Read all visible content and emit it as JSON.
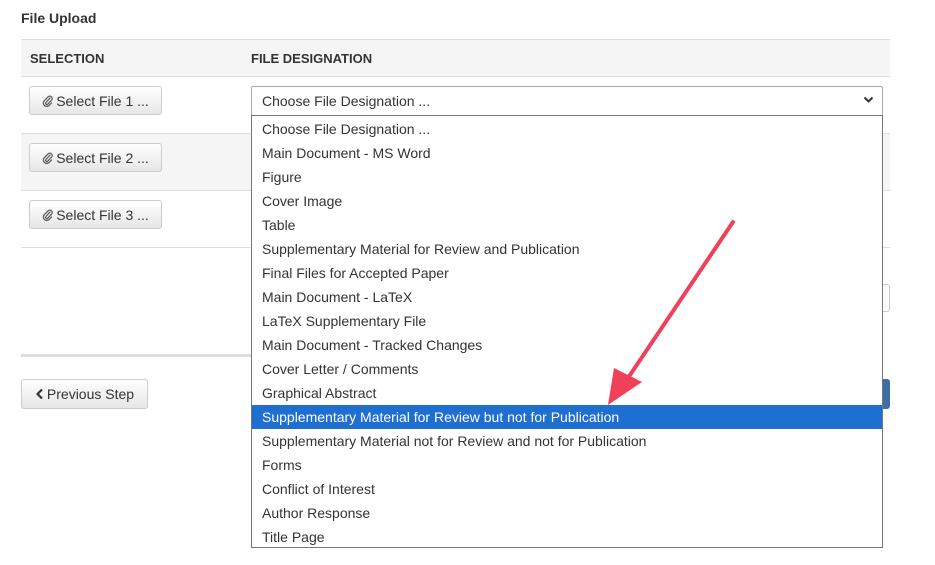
{
  "title": "File Upload",
  "table": {
    "col_selection": "SELECTION",
    "col_designation": "FILE DESIGNATION"
  },
  "rows": [
    {
      "button": "Select File 1 ..."
    },
    {
      "button": "Select File 2 ..."
    },
    {
      "button": "Select File 3 ..."
    }
  ],
  "select": {
    "value": "Choose File Designation ...",
    "highlighted_index": 12
  },
  "options": [
    "Choose File Designation ...",
    "Main Document - MS Word",
    "Figure",
    "Cover Image",
    "Table",
    "Supplementary Material for Review and Publication",
    "Final Files for Accepted Paper",
    "Main Document - LaTeX",
    "LaTeX Supplementary File",
    "Main Document - Tracked Changes",
    "Cover Letter / Comments",
    "Graphical Abstract",
    "Supplementary Material for Review but not for Publication",
    "Supplementary Material not for Review and not for Publication",
    "Forms",
    "Conflict of Interest",
    "Author Response",
    "Title Page"
  ],
  "prev_button": "Previous Step",
  "colors": {
    "highlight": "#1e6fd0",
    "arrow": "#f0405a",
    "primary": "#3b6fa5"
  },
  "icons": {
    "file_button": "paperclip-icon",
    "prev_button": "chevron-left-icon",
    "select": "chevron-down-icon"
  }
}
